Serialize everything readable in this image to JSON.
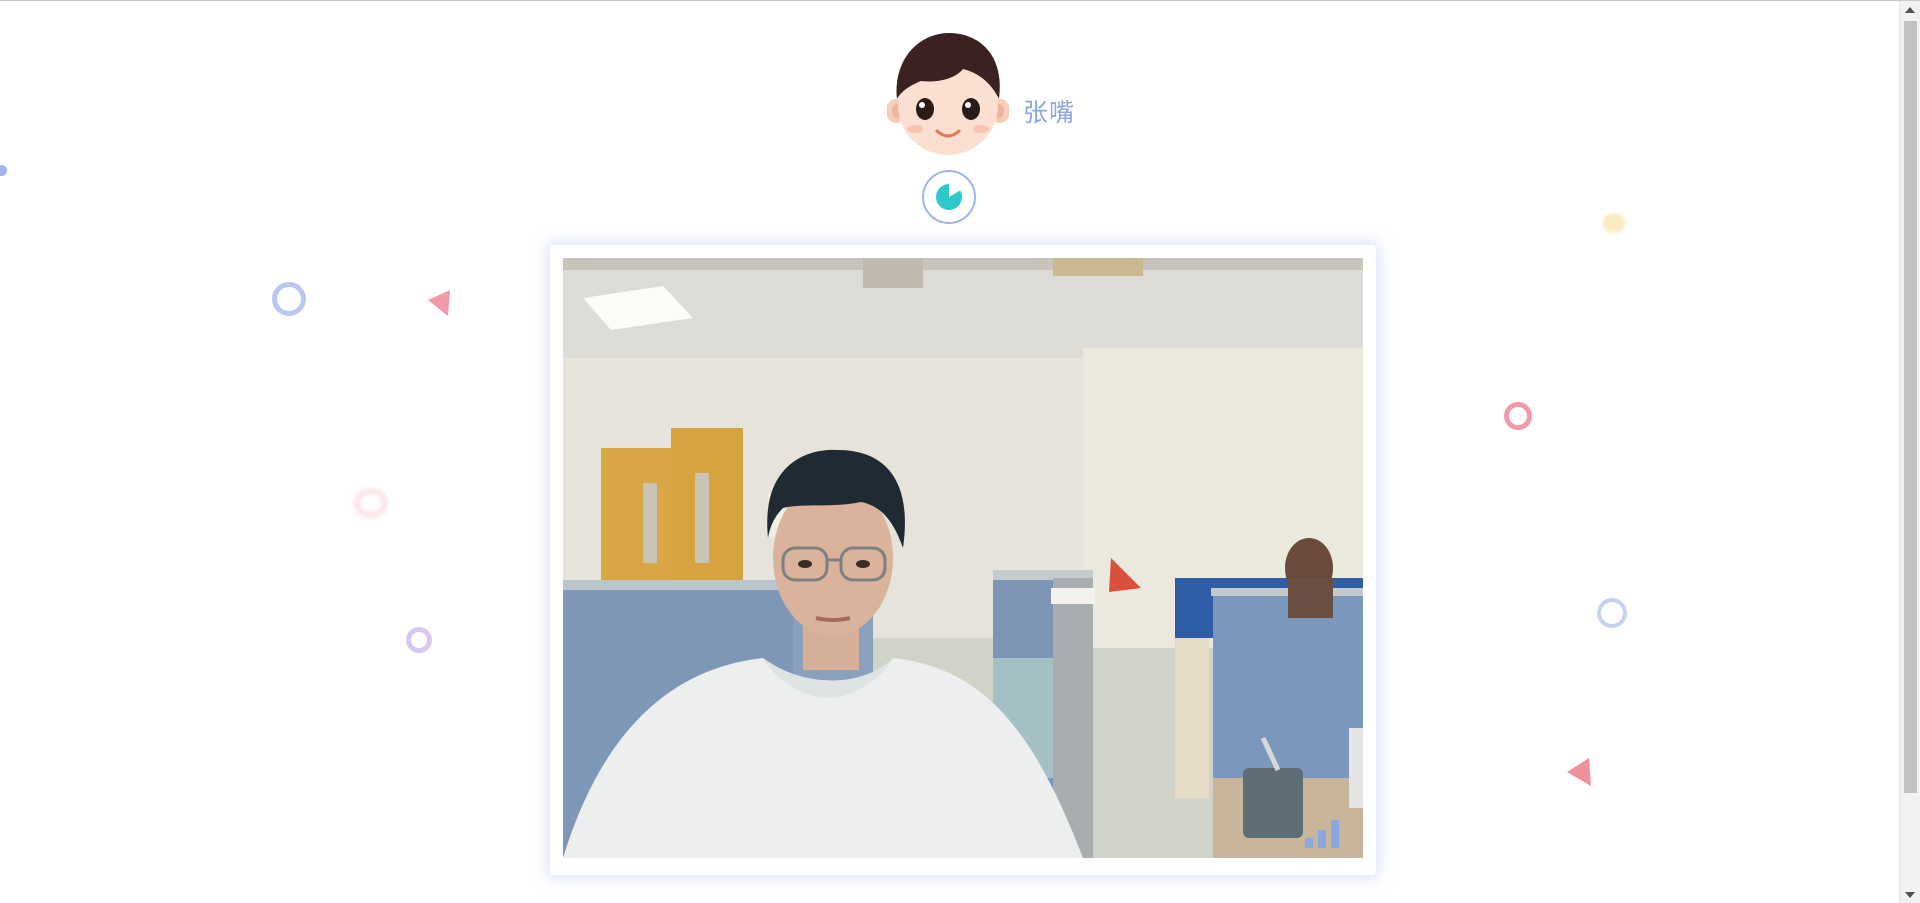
{
  "user": {
    "name": "张嘴"
  },
  "colors": {
    "accent": "#8aa8e0",
    "timer_fill": "#2fc9c9",
    "ring_blue": "#b8c8ee",
    "ring_pink": "#f29aa8",
    "ring_purple": "#d4c0ec",
    "triangle_pink": "#f0909e",
    "dot_yellow": "#f5e6a8"
  },
  "icons": {
    "avatar": "cartoon-boy-avatar",
    "timer": "pie-timer-icon",
    "signal": "signal-strength-icon"
  },
  "video": {
    "label": "camera-feed",
    "signal_bars": 3
  }
}
